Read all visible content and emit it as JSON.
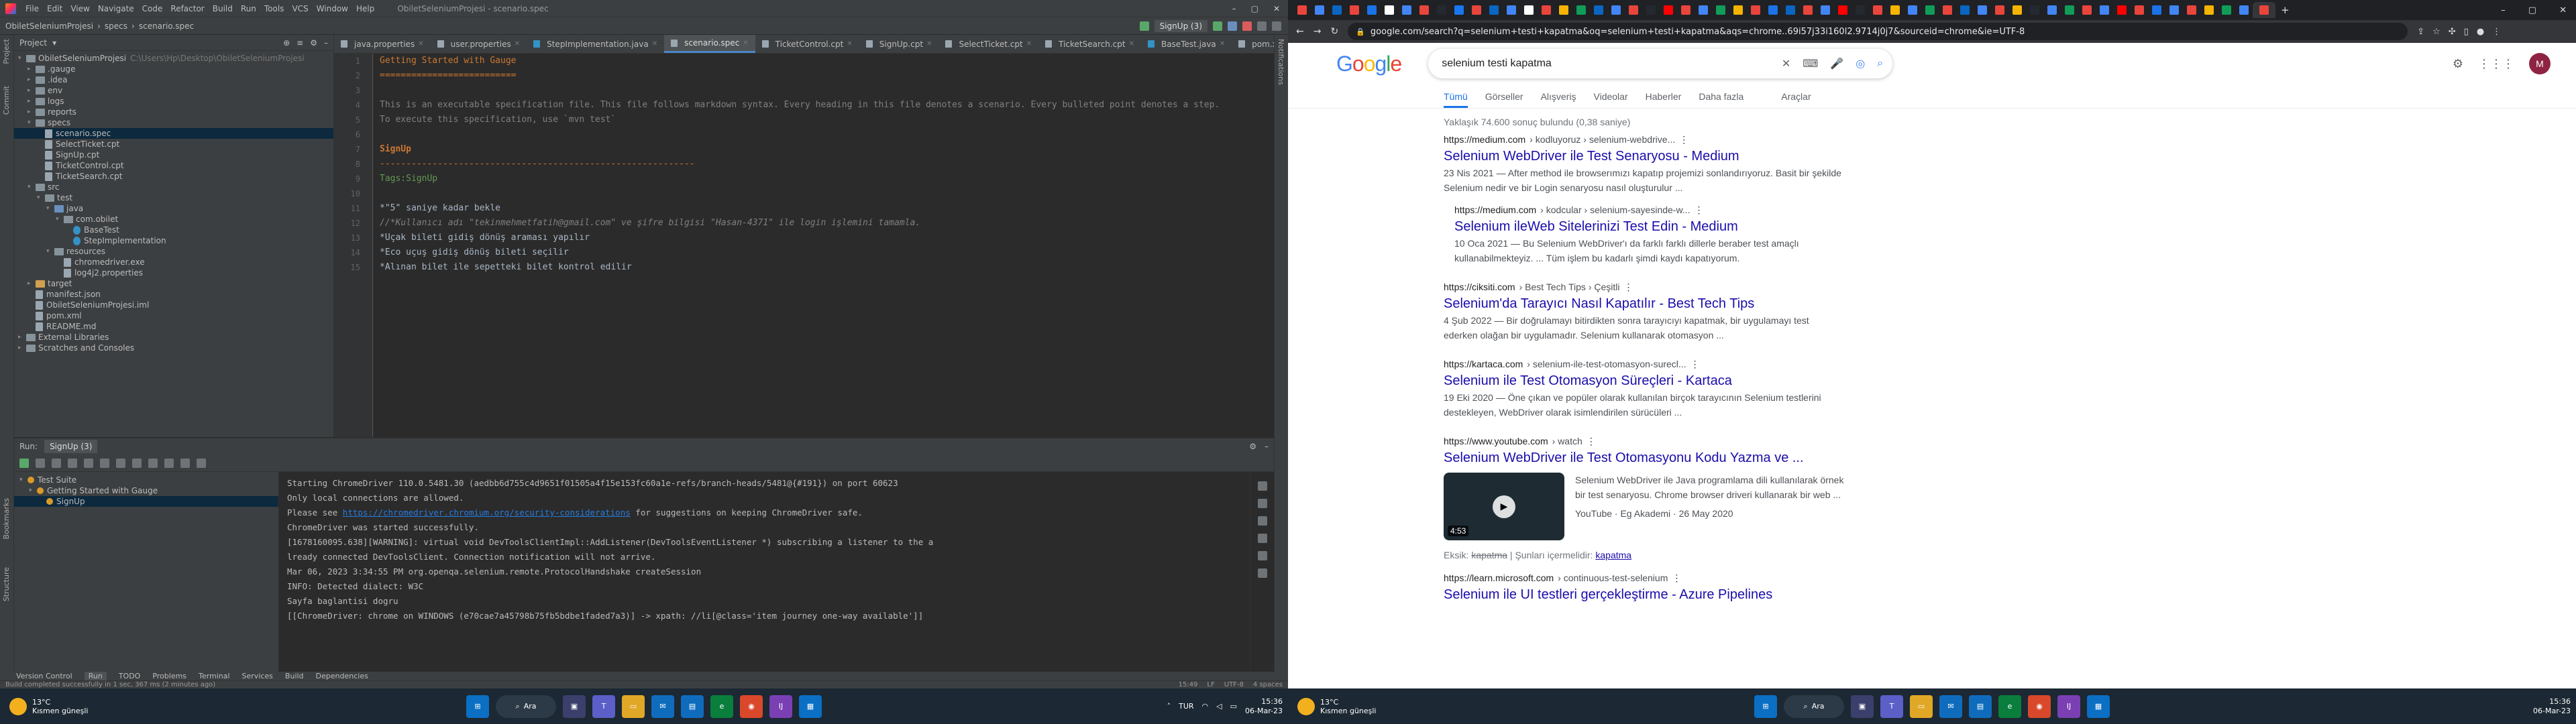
{
  "ide": {
    "menu": [
      "File",
      "Edit",
      "View",
      "Navigate",
      "Code",
      "Refactor",
      "Build",
      "Run",
      "Tools",
      "VCS",
      "Window",
      "Help"
    ],
    "window_title": "ObiletSeleniumProjesi - scenario.spec",
    "breadcrumb": [
      "ObiletSeleniumProjesi",
      "specs",
      "scenario.spec"
    ],
    "run_config": "SignUp (3)",
    "project_header": "Project",
    "tree": [
      {
        "label": "ObiletSeleniumProjesi",
        "extra": "C:\\Users\\Hp\\Desktop\\ObiletSeleniumProjesi",
        "level": 0,
        "type": "folder",
        "open": true
      },
      {
        "label": ".gauge",
        "level": 1,
        "type": "folder"
      },
      {
        "label": ".idea",
        "level": 1,
        "type": "folder"
      },
      {
        "label": "env",
        "level": 1,
        "type": "folder"
      },
      {
        "label": "logs",
        "level": 1,
        "type": "folder"
      },
      {
        "label": "reports",
        "level": 1,
        "type": "folder"
      },
      {
        "label": "specs",
        "level": 1,
        "type": "folder",
        "open": true
      },
      {
        "label": "scenario.spec",
        "level": 2,
        "type": "file",
        "selected": true
      },
      {
        "label": "SelectTicket.cpt",
        "level": 2,
        "type": "file"
      },
      {
        "label": "SignUp.cpt",
        "level": 2,
        "type": "file"
      },
      {
        "label": "TicketControl.cpt",
        "level": 2,
        "type": "file"
      },
      {
        "label": "TicketSearch.cpt",
        "level": 2,
        "type": "file"
      },
      {
        "label": "src",
        "level": 1,
        "type": "folder",
        "open": true
      },
      {
        "label": "test",
        "level": 2,
        "type": "folder",
        "open": true
      },
      {
        "label": "java",
        "level": 3,
        "type": "src",
        "open": true
      },
      {
        "label": "com.obilet",
        "level": 4,
        "type": "folder",
        "open": true
      },
      {
        "label": "BaseTest",
        "level": 5,
        "type": "class"
      },
      {
        "label": "StepImplementation",
        "level": 5,
        "type": "class"
      },
      {
        "label": "resources",
        "level": 3,
        "type": "folder",
        "open": true
      },
      {
        "label": "chromedriver.exe",
        "level": 4,
        "type": "file"
      },
      {
        "label": "log4j2.properties",
        "level": 4,
        "type": "file"
      },
      {
        "label": "target",
        "level": 1,
        "type": "excl"
      },
      {
        "label": "manifest.json",
        "level": 1,
        "type": "file"
      },
      {
        "label": "ObiletSeleniumProjesi.iml",
        "level": 1,
        "type": "file"
      },
      {
        "label": "pom.xml",
        "level": 1,
        "type": "file"
      },
      {
        "label": "README.md",
        "level": 1,
        "type": "file"
      },
      {
        "label": "External Libraries",
        "level": 0,
        "type": "folder"
      },
      {
        "label": "Scratches and Consoles",
        "level": 0,
        "type": "folder"
      }
    ],
    "tabs": [
      "java.properties",
      "user.properties",
      "StepImplementation.java",
      "scenario.spec",
      "TicketControl.cpt",
      "SignUp.cpt",
      "SelectTicket.cpt",
      "TicketSearch.cpt",
      "BaseTest.java",
      "pom.xml (gauge-test)"
    ],
    "active_tab": 3,
    "code": [
      {
        "n": "1",
        "cls": "c-h1",
        "t": "Getting Started with Gauge"
      },
      {
        "n": "2",
        "cls": "c-sep",
        "t": "=========================="
      },
      {
        "n": "3",
        "cls": "c-txt",
        "t": ""
      },
      {
        "n": "4",
        "cls": "c-txt",
        "t": "This is an executable specification file. This file follows markdown syntax. Every heading in this file denotes a scenario. Every bulleted point denotes a step."
      },
      {
        "n": "5",
        "cls": "c-txt",
        "t": "To execute this specification, use `mvn test`"
      },
      {
        "n": "6",
        "cls": "c-txt",
        "t": ""
      },
      {
        "n": "7",
        "cls": "c-h2",
        "t": "SignUp"
      },
      {
        "n": "8",
        "cls": "c-sep",
        "t": "------------------------------------------------------------"
      },
      {
        "n": "9",
        "cls": "c-tag",
        "t": "Tags:SignUp"
      },
      {
        "n": "10",
        "cls": "c-txt",
        "t": ""
      },
      {
        "n": "11",
        "cls": "c-step",
        "t": "*\"5\" saniye kadar bekle"
      },
      {
        "n": "12",
        "cls": "c-cmt",
        "t": "//*Kullanıcı adı \"tekinmehmetfatih@gmail.com\" ve şifre bilgisi \"Hasan-4371\" ile login işlemini tamamla."
      },
      {
        "n": "13",
        "cls": "c-step",
        "t": "*Uçak bileti gidiş dönüş araması yapılır"
      },
      {
        "n": "14",
        "cls": "c-step",
        "t": "*Eco uçuş gidiş dönüş bileti seçilir"
      },
      {
        "n": "15",
        "cls": "c-step",
        "t": "*Alınan bilet ile sepetteki bilet kontrol edilir"
      }
    ],
    "run": {
      "header": "Run:",
      "tab": "SignUp (3)",
      "tree": [
        {
          "label": "Test Suite",
          "level": 0
        },
        {
          "label": "Getting Started with Gauge",
          "level": 1
        },
        {
          "label": "SignUp",
          "level": 2,
          "selected": true
        }
      ],
      "console": [
        {
          "t": "Starting ChromeDriver 110.0.5481.30 (aedbb6d755c4d9651f01505a4f15e153fc60a1e-refs/branch-heads/5481@{#191}) on port 60623"
        },
        {
          "t": "Only local connections are allowed."
        },
        {
          "t": "Please see ",
          "link": "https://chromedriver.chromium.org/security-considerations",
          "after": " for suggestions on keeping ChromeDriver safe."
        },
        {
          "t": "ChromeDriver was started successfully."
        },
        {
          "t": "[1678160095.638][WARNING]: virtual void DevToolsClientImpl::AddListener(DevToolsEventListener *) subscribing a listener to the a"
        },
        {
          "t": "lready connected DevToolsClient. Connection notification will not arrive."
        },
        {
          "t": "Mar 06, 2023 3:34:55 PM org.openqa.selenium.remote.ProtocolHandshake createSession"
        },
        {
          "t": "INFO: Detected dialect: W3C"
        },
        {
          "t": "Sayfa baglantisi dogru"
        },
        {
          "t": "[[ChromeDriver: chrome on WINDOWS (e70cae7a45798b75fb5bdbe1faded7a3)] -> xpath: //li[@class='item journey one-way available']]"
        }
      ]
    },
    "bottom_tabs": [
      "Version Control",
      "Run",
      "TODO",
      "Problems",
      "Terminal",
      "Services",
      "Build",
      "Dependencies"
    ],
    "status_left": "Build completed successfully in 1 sec, 367 ms (2 minutes ago)",
    "status_right": [
      "15:49",
      "LF",
      "UTF-8",
      "4 spaces"
    ]
  },
  "chrome": {
    "url": "google.com/search?q=selenium+testi+kapatma&oq=selenium+testi+kapatma&aqs=chrome..69i57j33i160l2.9714j0j7&sourceid=chrome&ie=UTF-8",
    "query": "selenium testi kapatma",
    "avatar": "M",
    "filters": [
      "Tümü",
      "Görseller",
      "Alışveriş",
      "Videolar",
      "Haberler",
      "Daha fazla",
      "Araçlar"
    ],
    "stats": "Yaklaşık 74.600 sonuç bulundu (0,38 saniye)",
    "results": [
      {
        "site": "https://medium.com",
        "path": "› kodluyoruz › selenium-webdrive...",
        "title": "Selenium WebDriver ile Test Senaryosu - Medium",
        "snip1": "23 Nis 2021 — After method ile browserımızı kapatıp projemizi sonlandırıyoruz. Basit bir şekilde",
        "snip2": "Selenium nedir ve bir Login senaryosu nasıl oluşturulur ..."
      },
      {
        "site": "https://medium.com",
        "path": "› kodcular › selenium-sayesinde-w...",
        "title": "Selenium ileWeb Sitelerinizi Test Edin - Medium",
        "snip1": "10 Oca 2021 — Bu Selenium WebDriver'ı da farklı farklı dillerle beraber test amaçlı",
        "snip2": "kullanabilmekteyiz. ... Tüm işlem bu kadarlı şimdi kaydı kapatıyorum.",
        "indent": true
      },
      {
        "site": "https://ciksiti.com",
        "path": "› Best Tech Tips › Çeşitli",
        "title": "Selenium'da Tarayıcı Nasıl Kapatılır - Best Tech Tips",
        "snip1": "4 Şub 2022 — Bir doğrulamayı bitirdikten sonra tarayıcıyı kapatmak, bir uygulamayı test",
        "snip2": "ederken olağan bir uygulamadır. Selenium kullanarak otomasyon ..."
      },
      {
        "site": "https://kartaca.com",
        "path": "› selenium-ile-test-otomasyon-surecl...",
        "title": "Selenium ile Test Otomasyon Süreçleri - Kartaca",
        "snip1": "19 Eki 2020 — Öne çıkan ve popüler olarak kullanılan birçok tarayıcının Selenium testlerini",
        "snip2": "destekleyen, WebDriver olarak isimlendirilen sürücüleri ..."
      },
      {
        "site": "https://www.youtube.com",
        "path": "› watch",
        "title": "Selenium WebDriver ile Test Otomasyonu Kodu Yazma ve ...",
        "snip1": "Selenium WebDriver ile Java programlama dili kullanılarak örnek",
        "snip2": "bir test senaryosu. Chrome browser driveri kullanarak bir web ...",
        "video": true,
        "duration": "4:53",
        "channel": "YouTube · Eg Akademi · 26 May 2020"
      },
      {
        "site": "https://learn.microsoft.com",
        "path": "› continuous-test-selenium",
        "title": "Selenium ile UI testleri gerçekleştirme - Azure Pipelines"
      }
    ],
    "missing": {
      "label": "Eksik:",
      "word": "kapatma",
      "sep": " | Şunları içermelidir:",
      "link": "kapatma"
    }
  },
  "taskbar": {
    "temp": "13°C",
    "weather": "Kısmen güneşli",
    "search": "Ara",
    "lang": "TUR",
    "time": "15:36",
    "date": "06-Mar-23"
  }
}
